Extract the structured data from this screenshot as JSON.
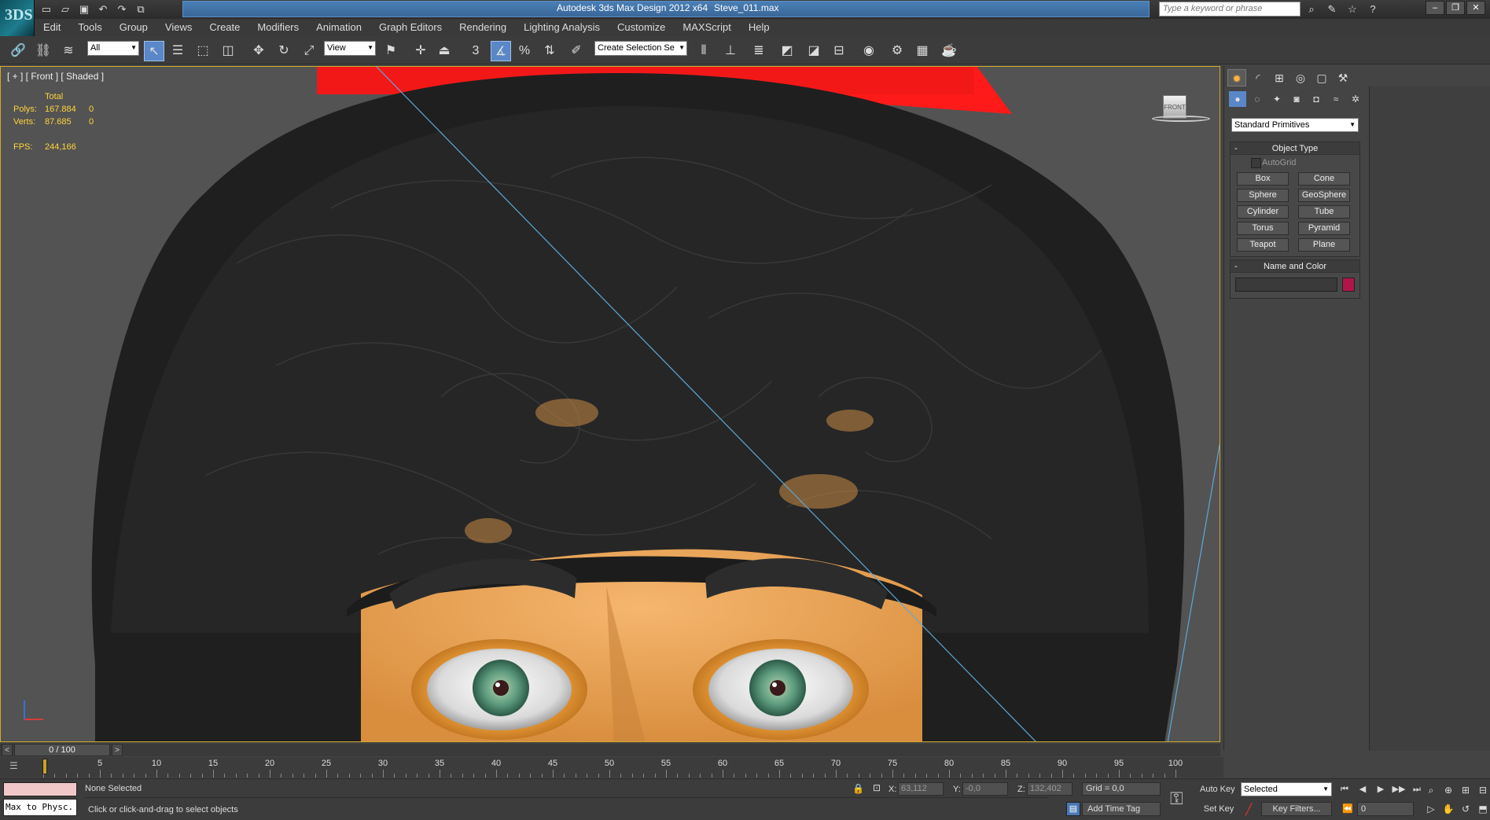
{
  "title_bar": {
    "app_logo": "3DS",
    "app_title": "Autodesk 3ds Max Design 2012 x64",
    "file_name": "Steve_011.max",
    "search_placeholder": "Type a keyword or phrase",
    "quick_access_icons": [
      "new-icon",
      "open-icon",
      "save-icon",
      "undo-icon",
      "redo-icon",
      "project-icon"
    ],
    "help_icons": [
      "binoculars-icon",
      "tools-icon",
      "star-icon",
      "help-icon"
    ]
  },
  "menu": {
    "items": [
      "Edit",
      "Tools",
      "Group",
      "Views",
      "Create",
      "Modifiers",
      "Animation",
      "Graph Editors",
      "Rendering",
      "Lighting Analysis",
      "Customize",
      "MAXScript",
      "Help"
    ]
  },
  "toolbar": {
    "selection_filter": "All",
    "reference_coord": "View",
    "named_selection": "Create Selection Se",
    "snap_label": "3",
    "angle_snap_label": "%"
  },
  "viewport": {
    "label": "[ + ] [ Front ] [ Shaded ]",
    "stats": {
      "header": "Total",
      "polys_label": "Polys:",
      "polys_value": "167.884",
      "polys_sel": "0",
      "verts_label": "Verts:",
      "verts_value": "87.685",
      "verts_sel": "0",
      "fps_label": "FPS:",
      "fps_value": "244,166"
    },
    "view_cube_label": "FRONT",
    "background": "#555555",
    "border_color": "#d2a92c"
  },
  "command_panel": {
    "tabs": [
      "create-tab",
      "modify-tab",
      "hierarchy-tab",
      "motion-tab",
      "display-tab",
      "utilities-tab"
    ],
    "category_dropdown": "Standard Primitives",
    "object_type": {
      "title": "Object Type",
      "autogrid": "AutoGrid",
      "buttons": [
        "Box",
        "Cone",
        "Sphere",
        "GeoSphere",
        "Cylinder",
        "Tube",
        "Torus",
        "Pyramid",
        "Teapot",
        "Plane"
      ]
    },
    "name_and_color": {
      "title": "Name and Color",
      "swatch_color": "#b0154a"
    }
  },
  "timeline": {
    "frame_display": "0 / 100",
    "ticks": [
      5,
      10,
      15,
      20,
      25,
      30,
      35,
      40,
      45,
      50,
      55,
      60,
      65,
      70,
      75,
      80,
      85,
      90,
      95,
      100
    ]
  },
  "status_bar": {
    "listener_text": "Max to Physc.",
    "selection_status": "None Selected",
    "prompt": "Click or click-and-drag to select objects",
    "x_label": "X:",
    "x_value": "63,112",
    "y_label": "Y:",
    "y_value": "-0,0",
    "z_label": "Z:",
    "z_value": "132,402",
    "grid": "Grid = 0,0",
    "add_time_tag": "Add Time Tag",
    "auto_key": "Auto Key",
    "set_key": "Set Key",
    "key_mode_dropdown": "Selected",
    "key_filters": "Key Filters...",
    "current_frame": "0"
  }
}
